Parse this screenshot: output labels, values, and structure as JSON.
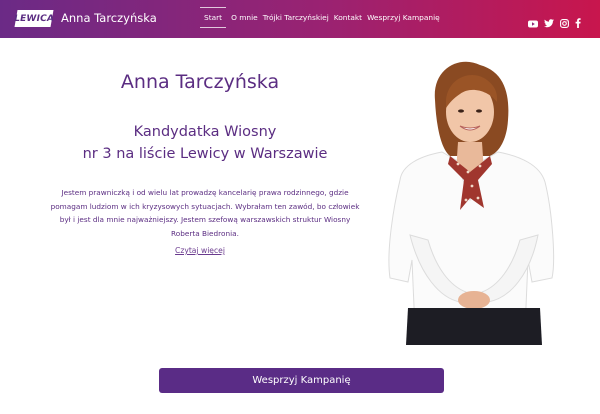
{
  "header": {
    "logo_text": "LEWICA",
    "site_name": "Anna Tarczyńska",
    "nav": [
      {
        "label": "Start"
      },
      {
        "label": "O mnie"
      },
      {
        "label": "Trójki Tarczyńskiej"
      },
      {
        "label": "Kontakt"
      },
      {
        "label": "Wesprzyj Kampanię"
      }
    ],
    "active_nav": "Start",
    "social_icons": [
      "youtube-icon",
      "twitter-icon",
      "instagram-icon",
      "facebook-icon"
    ]
  },
  "hero": {
    "name": "Anna Tarczyńska",
    "subtitle_line1": "Kandydatka Wiosny",
    "subtitle_line2": "nr 3 na liście Lewicy w Warszawie",
    "bio_lines": [
      "Jestem prawniczką i od wielu lat prowadzę kancelarię prawa rodzinnego, gdzie",
      "pomagam ludziom w ich kryzysowych sytuacjach. Wybrałam ten zawód, bo człowiek",
      "był i jest dla mnie najważniejszy. Jestem szefową warszawskich struktur Wiosny",
      "Roberta Biedronia."
    ],
    "read_more": "Czytaj więcej"
  },
  "cta": {
    "label": "Wesprzyj Kampanię"
  },
  "colors": {
    "brand_purple": "#5b2d82",
    "header_gradient_start": "#6b2a86",
    "header_gradient_end": "#c8164d",
    "cta_bg": "#5a2c86"
  }
}
